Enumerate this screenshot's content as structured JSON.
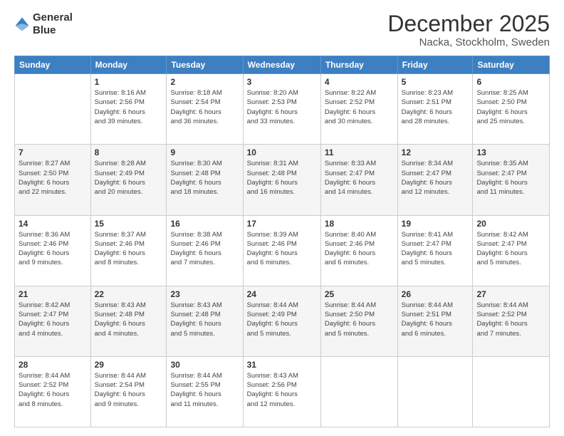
{
  "logo": {
    "line1": "General",
    "line2": "Blue"
  },
  "title": "December 2025",
  "subtitle": "Nacka, Stockholm, Sweden",
  "headers": [
    "Sunday",
    "Monday",
    "Tuesday",
    "Wednesday",
    "Thursday",
    "Friday",
    "Saturday"
  ],
  "weeks": [
    [
      {
        "day": "",
        "info": ""
      },
      {
        "day": "1",
        "info": "Sunrise: 8:16 AM\nSunset: 2:56 PM\nDaylight: 6 hours\nand 39 minutes."
      },
      {
        "day": "2",
        "info": "Sunrise: 8:18 AM\nSunset: 2:54 PM\nDaylight: 6 hours\nand 36 minutes."
      },
      {
        "day": "3",
        "info": "Sunrise: 8:20 AM\nSunset: 2:53 PM\nDaylight: 6 hours\nand 33 minutes."
      },
      {
        "day": "4",
        "info": "Sunrise: 8:22 AM\nSunset: 2:52 PM\nDaylight: 6 hours\nand 30 minutes."
      },
      {
        "day": "5",
        "info": "Sunrise: 8:23 AM\nSunset: 2:51 PM\nDaylight: 6 hours\nand 28 minutes."
      },
      {
        "day": "6",
        "info": "Sunrise: 8:25 AM\nSunset: 2:50 PM\nDaylight: 6 hours\nand 25 minutes."
      }
    ],
    [
      {
        "day": "7",
        "info": "Sunrise: 8:27 AM\nSunset: 2:50 PM\nDaylight: 6 hours\nand 22 minutes."
      },
      {
        "day": "8",
        "info": "Sunrise: 8:28 AM\nSunset: 2:49 PM\nDaylight: 6 hours\nand 20 minutes."
      },
      {
        "day": "9",
        "info": "Sunrise: 8:30 AM\nSunset: 2:48 PM\nDaylight: 6 hours\nand 18 minutes."
      },
      {
        "day": "10",
        "info": "Sunrise: 8:31 AM\nSunset: 2:48 PM\nDaylight: 6 hours\nand 16 minutes."
      },
      {
        "day": "11",
        "info": "Sunrise: 8:33 AM\nSunset: 2:47 PM\nDaylight: 6 hours\nand 14 minutes."
      },
      {
        "day": "12",
        "info": "Sunrise: 8:34 AM\nSunset: 2:47 PM\nDaylight: 6 hours\nand 12 minutes."
      },
      {
        "day": "13",
        "info": "Sunrise: 8:35 AM\nSunset: 2:47 PM\nDaylight: 6 hours\nand 11 minutes."
      }
    ],
    [
      {
        "day": "14",
        "info": "Sunrise: 8:36 AM\nSunset: 2:46 PM\nDaylight: 6 hours\nand 9 minutes."
      },
      {
        "day": "15",
        "info": "Sunrise: 8:37 AM\nSunset: 2:46 PM\nDaylight: 6 hours\nand 8 minutes."
      },
      {
        "day": "16",
        "info": "Sunrise: 8:38 AM\nSunset: 2:46 PM\nDaylight: 6 hours\nand 7 minutes."
      },
      {
        "day": "17",
        "info": "Sunrise: 8:39 AM\nSunset: 2:46 PM\nDaylight: 6 hours\nand 6 minutes."
      },
      {
        "day": "18",
        "info": "Sunrise: 8:40 AM\nSunset: 2:46 PM\nDaylight: 6 hours\nand 6 minutes."
      },
      {
        "day": "19",
        "info": "Sunrise: 8:41 AM\nSunset: 2:47 PM\nDaylight: 6 hours\nand 5 minutes."
      },
      {
        "day": "20",
        "info": "Sunrise: 8:42 AM\nSunset: 2:47 PM\nDaylight: 6 hours\nand 5 minutes."
      }
    ],
    [
      {
        "day": "21",
        "info": "Sunrise: 8:42 AM\nSunset: 2:47 PM\nDaylight: 6 hours\nand 4 minutes."
      },
      {
        "day": "22",
        "info": "Sunrise: 8:43 AM\nSunset: 2:48 PM\nDaylight: 6 hours\nand 4 minutes."
      },
      {
        "day": "23",
        "info": "Sunrise: 8:43 AM\nSunset: 2:48 PM\nDaylight: 6 hours\nand 5 minutes."
      },
      {
        "day": "24",
        "info": "Sunrise: 8:44 AM\nSunset: 2:49 PM\nDaylight: 6 hours\nand 5 minutes."
      },
      {
        "day": "25",
        "info": "Sunrise: 8:44 AM\nSunset: 2:50 PM\nDaylight: 6 hours\nand 5 minutes."
      },
      {
        "day": "26",
        "info": "Sunrise: 8:44 AM\nSunset: 2:51 PM\nDaylight: 6 hours\nand 6 minutes."
      },
      {
        "day": "27",
        "info": "Sunrise: 8:44 AM\nSunset: 2:52 PM\nDaylight: 6 hours\nand 7 minutes."
      }
    ],
    [
      {
        "day": "28",
        "info": "Sunrise: 8:44 AM\nSunset: 2:52 PM\nDaylight: 6 hours\nand 8 minutes."
      },
      {
        "day": "29",
        "info": "Sunrise: 8:44 AM\nSunset: 2:54 PM\nDaylight: 6 hours\nand 9 minutes."
      },
      {
        "day": "30",
        "info": "Sunrise: 8:44 AM\nSunset: 2:55 PM\nDaylight: 6 hours\nand 11 minutes."
      },
      {
        "day": "31",
        "info": "Sunrise: 8:43 AM\nSunset: 2:56 PM\nDaylight: 6 hours\nand 12 minutes."
      },
      {
        "day": "",
        "info": ""
      },
      {
        "day": "",
        "info": ""
      },
      {
        "day": "",
        "info": ""
      }
    ]
  ]
}
